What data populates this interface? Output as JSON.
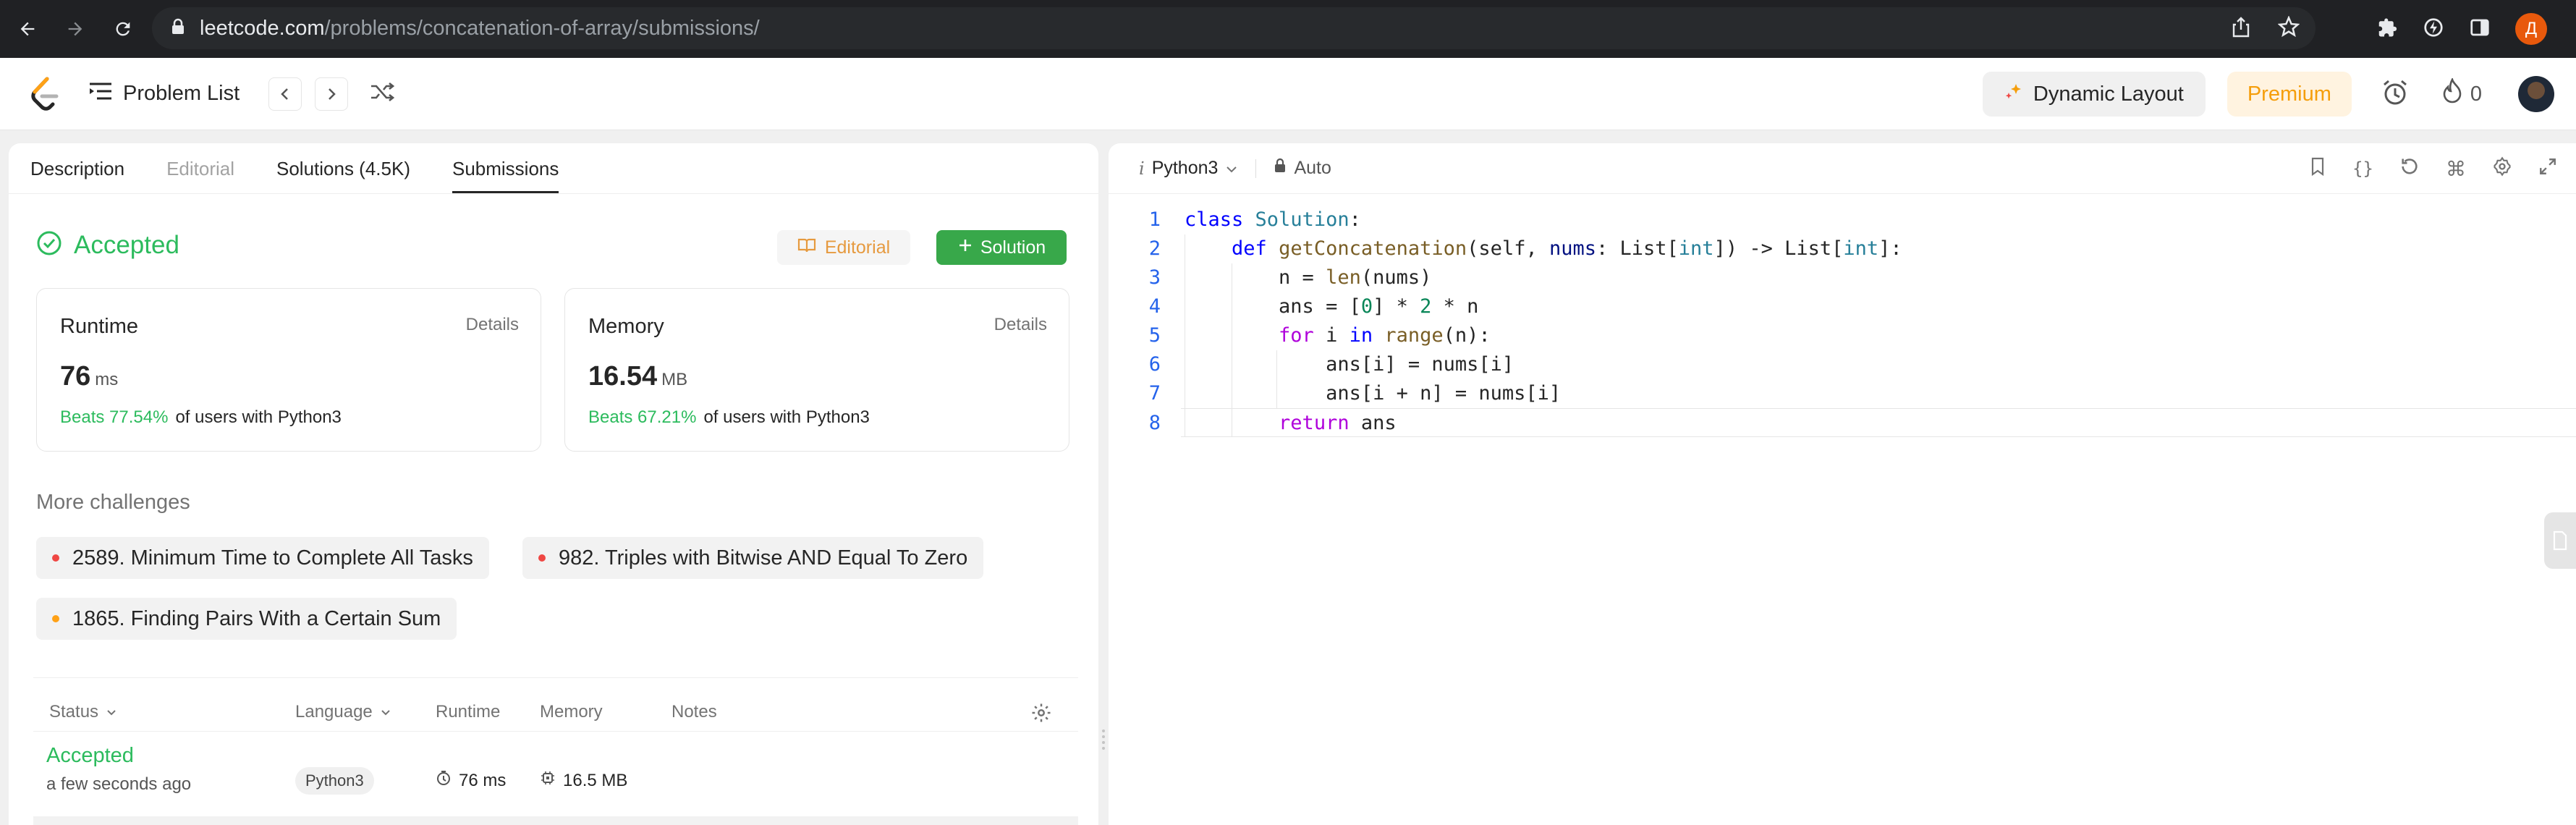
{
  "browser": {
    "url_host": "leetcode.com",
    "url_path": "/problems/concatenation-of-array/submissions/",
    "profile_initial": "Д"
  },
  "topbar": {
    "problem_list": "Problem List",
    "dynamic_layout": "Dynamic Layout",
    "premium": "Premium",
    "streak_count": "0"
  },
  "tabs": [
    {
      "label": "Description"
    },
    {
      "label": "Editorial"
    },
    {
      "label": "Solutions (4.5K)"
    },
    {
      "label": "Submissions"
    }
  ],
  "result": {
    "status": "Accepted",
    "editorial_btn": "Editorial",
    "solution_btn": "Solution",
    "runtime": {
      "title": "Runtime",
      "details": "Details",
      "value": "76",
      "unit": "ms",
      "beats": "Beats 77.54%",
      "suffix": "of users with Python3"
    },
    "memory": {
      "title": "Memory",
      "details": "Details",
      "value": "16.54",
      "unit": "MB",
      "beats": "Beats 67.21%",
      "suffix": "of users with Python3"
    }
  },
  "more": {
    "title": "More challenges",
    "items": [
      {
        "label": "2589. Minimum Time to Complete All Tasks",
        "color": "#ef4743"
      },
      {
        "label": "982. Triples with Bitwise AND Equal To Zero",
        "color": "#ef4743"
      },
      {
        "label": "1865. Finding Pairs With a Certain Sum",
        "color": "#ffa116"
      }
    ]
  },
  "table": {
    "headers": {
      "status": "Status",
      "language": "Language",
      "runtime": "Runtime",
      "memory": "Memory",
      "notes": "Notes"
    },
    "rows": [
      {
        "status": "Accepted",
        "time": "a few seconds ago",
        "language": "Python3",
        "runtime": "76 ms",
        "memory": "16.5 MB"
      }
    ]
  },
  "editor": {
    "language": "Python3",
    "mode": "Auto"
  },
  "colors": {
    "accepted_green": "#2cbb5d",
    "solution_button": "#38a84a",
    "editorial_orange": "#e69a3f",
    "premium_orange": "#f59e0b"
  }
}
